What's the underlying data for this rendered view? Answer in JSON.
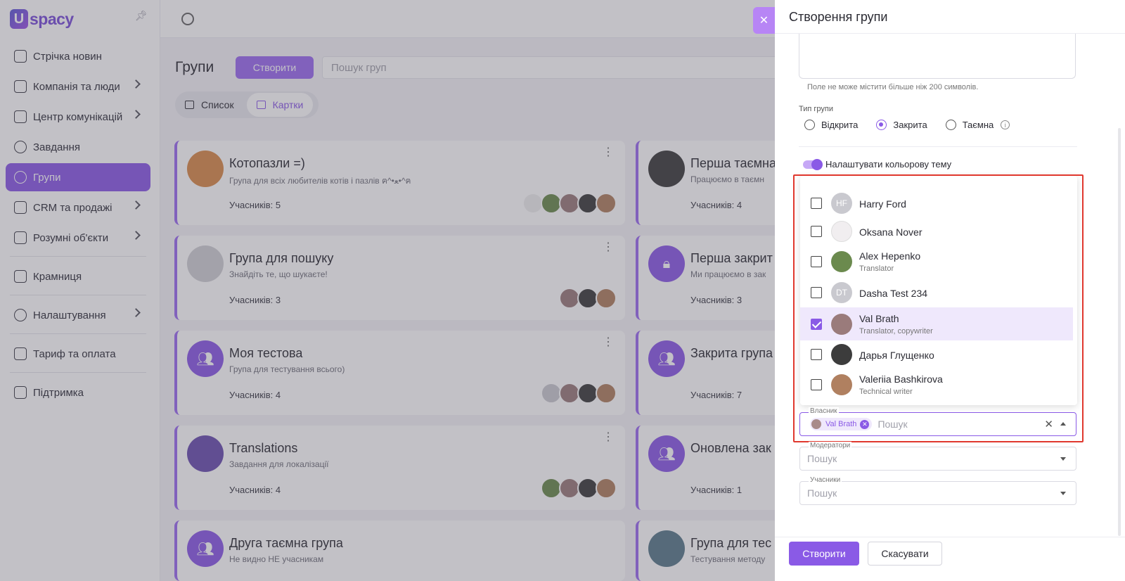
{
  "brand": {
    "logo_letter": "U",
    "logo_text": "spacy"
  },
  "sidebar": {
    "items": [
      {
        "label": "Стрічка новин",
        "icon": "home-icon",
        "chevron": false
      },
      {
        "label": "Компанія та люди",
        "icon": "building-icon",
        "chevron": true
      },
      {
        "label": "Центр комунікацій",
        "icon": "chat-icon",
        "chevron": true
      },
      {
        "label": "Завдання",
        "icon": "check-circle-icon",
        "chevron": false
      },
      {
        "label": "Групи",
        "icon": "users-icon",
        "chevron": false,
        "active": true
      },
      {
        "label": "CRM та продажі",
        "icon": "database-icon",
        "chevron": true
      },
      {
        "label": "Розумні об'єкти",
        "icon": "smart-object-icon",
        "chevron": true
      },
      {
        "label": "Крамниця",
        "icon": "store-icon",
        "chevron": false
      },
      {
        "label": "Налаштування",
        "icon": "gear-icon",
        "chevron": true
      },
      {
        "label": "Тариф та оплата",
        "icon": "wallet-icon",
        "chevron": false
      },
      {
        "label": "Підтримка",
        "icon": "help-icon",
        "chevron": false
      }
    ]
  },
  "groups_page": {
    "title": "Групи",
    "create_label": "Створити",
    "search_placeholder": "Пошук груп",
    "view_list_label": "Список",
    "view_cards_label": "Картки"
  },
  "cards": [
    {
      "name": "Котопазли =)",
      "desc": "Група для всіх любителів котів і пазлів ฅ^•ﻌ•^ฅ",
      "count": "Учасників: 5"
    },
    {
      "name": "Група для пошуку",
      "desc": "Знайдіть те, що шукаєте!",
      "count": "Учасників: 3"
    },
    {
      "name": "Моя тестова",
      "desc": "Група для тестування всього)",
      "count": "Учасників: 4"
    },
    {
      "name": "Translations",
      "desc": "Завдання для локалізації",
      "count": "Учасників: 4"
    },
    {
      "name": "Друга таємна група",
      "desc": "Не видно НЕ учасникам",
      "count": ""
    }
  ],
  "cards_right": [
    {
      "name": "Перша таємна",
      "desc": "Працюємо в таємн",
      "count": "Учасників: 4"
    },
    {
      "name": "Перша закрит",
      "desc": "Ми працюємо в зак",
      "count": "Учасників: 3"
    },
    {
      "name": "Закрита група",
      "desc": "",
      "count": "Учасників: 7"
    },
    {
      "name": "Оновлена зак",
      "desc": "",
      "count": "Учасників: 1"
    },
    {
      "name": "Група для тес",
      "desc": "Тестування методу",
      "count": ""
    }
  ],
  "drawer": {
    "title": "Створення групи",
    "hint": "Поле не може містити більше ніж 200 символів.",
    "type_label": "Тип групи",
    "types": [
      "Відкрита",
      "Закрита",
      "Таємна"
    ],
    "selected_type": "Закрита",
    "color_theme_label": "Налаштувати кольорову тему",
    "owner_label": "Власник",
    "owner_chip": "Val Brath",
    "search_placeholder": "Пошук",
    "moderators_label": "Модератори",
    "members_label": "Учасники",
    "submit_label": "Створити",
    "cancel_label": "Скасувати"
  },
  "people": [
    {
      "initials": "HF",
      "name": "Harry Ford",
      "role": "",
      "checked": false,
      "color": "#c9c9cf"
    },
    {
      "initials": "",
      "name": "Oksana Nover",
      "role": "",
      "checked": false,
      "color": "#f1eef0"
    },
    {
      "initials": "",
      "name": "Alex Hepenko",
      "role": "Translator",
      "checked": false,
      "color": "#6b8a4e"
    },
    {
      "initials": "DT",
      "name": "Dasha Test 234",
      "role": "",
      "checked": false,
      "color": "#c9c9cf"
    },
    {
      "initials": "",
      "name": "Val Brath",
      "role": "Translator, copywriter",
      "checked": true,
      "color": "#9a7b7b"
    },
    {
      "initials": "",
      "name": "Дарья Глущенко",
      "role": "",
      "checked": false,
      "color": "#3c3c3c"
    },
    {
      "initials": "",
      "name": "Valeriia Bashkirova",
      "role": "Technical writer",
      "checked": false,
      "color": "#b08060"
    }
  ],
  "colors": {
    "accent": "#8a5ae6",
    "highlight": "#e0382e"
  }
}
